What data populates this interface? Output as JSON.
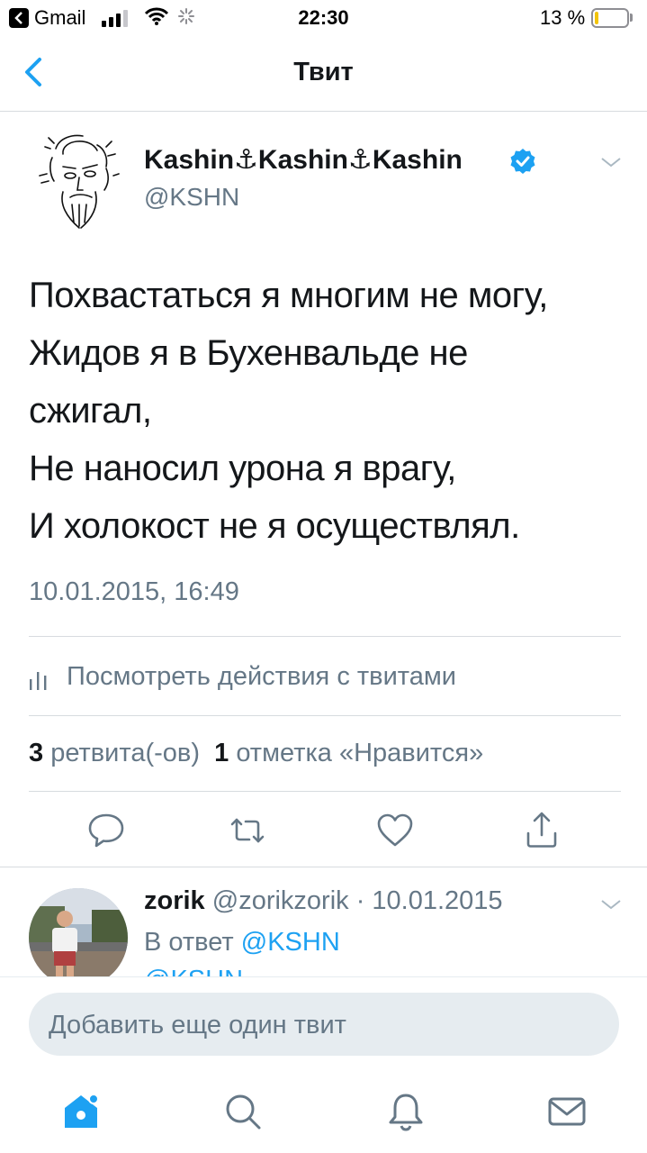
{
  "status_bar": {
    "back_app": "Gmail",
    "time": "22:30",
    "battery": "13 %",
    "battery_level": 0.13
  },
  "nav": {
    "title": "Твит"
  },
  "tweet": {
    "author_name": "Kashin⚓Kashin⚓Kashin",
    "handle": "@KSHN",
    "text": "Похвастаться я многим не могу,\nЖидов я в Бухенвальде не\nсжигал,\nНе наносил урона я врагу,\nИ холокост не я осуществлял.",
    "timestamp": "10.01.2015, 16:49",
    "analytics_label": "Посмотреть действия с твитами",
    "retweets_count": "3",
    "retweets_label": "ретвита(-ов)",
    "likes_count": "1",
    "likes_label": "отметка «Нравится»"
  },
  "reply": {
    "name": "zorik",
    "handle_date": "@zorikzorik · 10.01.2015",
    "reply_prefix": "В ответ",
    "reply_to": "@KSHN",
    "cut_line": "@KSHN"
  },
  "compose": {
    "placeholder": "Добавить еще один твит"
  },
  "tabbar": {
    "items": [
      "home-icon",
      "search-icon",
      "notifications-icon",
      "messages-icon"
    ],
    "active_color": "#1da1f2"
  },
  "colors": {
    "accent": "#1da1f2",
    "secondary_text": "#657786",
    "primary_text": "#14171a"
  }
}
